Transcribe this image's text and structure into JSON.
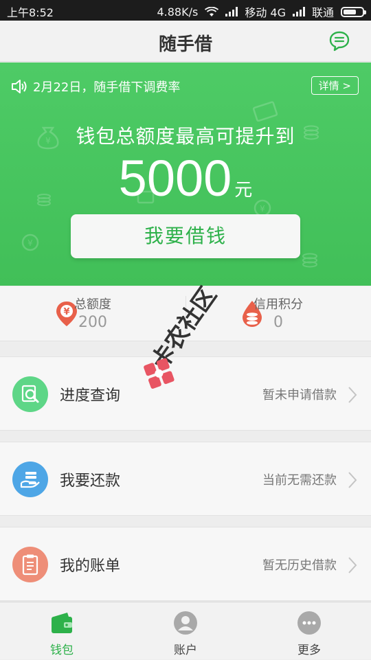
{
  "status_bar": {
    "time": "上午8:52",
    "speed": "4.88K/s",
    "network": "移动 4G",
    "carrier": "联通"
  },
  "header": {
    "title": "随手借",
    "icon": "chat-bubble-icon"
  },
  "banner": {
    "notice": "2月22日，随手借下调费率",
    "detail_label": "详情 >",
    "headline": "钱包总额度最高可提升到",
    "amount": "5000",
    "unit": "元",
    "borrow_label": "我要借钱"
  },
  "stats": [
    {
      "label": "总额度",
      "value": "200",
      "icon": "location-yuan-icon"
    },
    {
      "label": "信用积分",
      "value": "0",
      "icon": "coins-drop-icon"
    }
  ],
  "menu": [
    {
      "label": "进度查询",
      "status": "暂未申请借款",
      "icon": "search-document-icon",
      "color": "#5ed687"
    },
    {
      "label": "我要还款",
      "status": "当前无需还款",
      "icon": "hand-money-icon",
      "color": "#4ea6e6"
    },
    {
      "label": "我的账单",
      "status": "暂无历史借款",
      "icon": "clipboard-icon",
      "color": "#ee8e78"
    }
  ],
  "tabs": [
    {
      "label": "钱包",
      "icon": "wallet-icon",
      "active": true
    },
    {
      "label": "账户",
      "icon": "user-icon",
      "active": false
    },
    {
      "label": "更多",
      "icon": "more-icon",
      "active": false
    }
  ],
  "watermark": "卡农社区",
  "colors": {
    "brand_green": "#41bf58",
    "accent_green": "#2db14a",
    "pin_red": "#e8604a"
  }
}
